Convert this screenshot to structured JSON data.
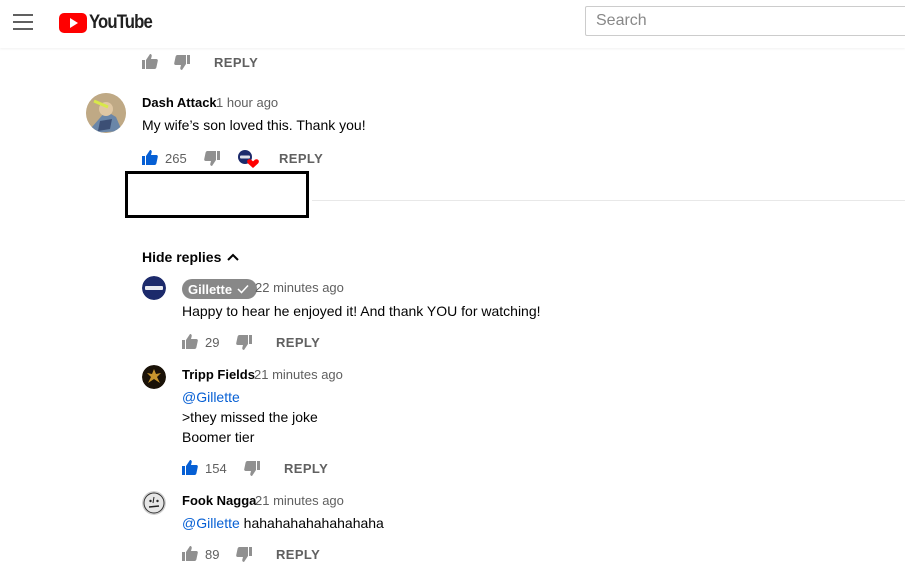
{
  "header": {
    "logo_text": "YouTube",
    "search_placeholder": "Search"
  },
  "top_actions": {
    "reply_label": "REPLY"
  },
  "comment": {
    "author": "Dash Attack",
    "time": "1 hour ago",
    "text": "My wife’s son loved this. Thank you!",
    "likes": "265",
    "reply_label": "REPLY",
    "creator_heart": true
  },
  "replies_toggle": {
    "label": "Hide replies"
  },
  "replies": [
    {
      "author": "Gillette",
      "verified": true,
      "time": "22 minutes ago",
      "text": "Happy to hear he enjoyed it! And thank YOU for watching!",
      "likes": "29",
      "reply_label": "REPLY"
    },
    {
      "author": "Tripp Fields",
      "time": "21 minutes ago",
      "mention": "@Gillette",
      "line2": ">they missed the joke",
      "line3": "Boomer tier",
      "likes": "154",
      "reply_label": "REPLY"
    },
    {
      "author": "Fook Nagga",
      "time": "21 minutes ago",
      "mention": "@Gillette",
      "text": " hahahahahahahahaha",
      "likes": "89",
      "reply_label": "REPLY"
    }
  ],
  "colors": {
    "liked_blue": "#065fd4",
    "youtube_red": "#ff0000",
    "gillette_navy": "#1c2a6b"
  }
}
